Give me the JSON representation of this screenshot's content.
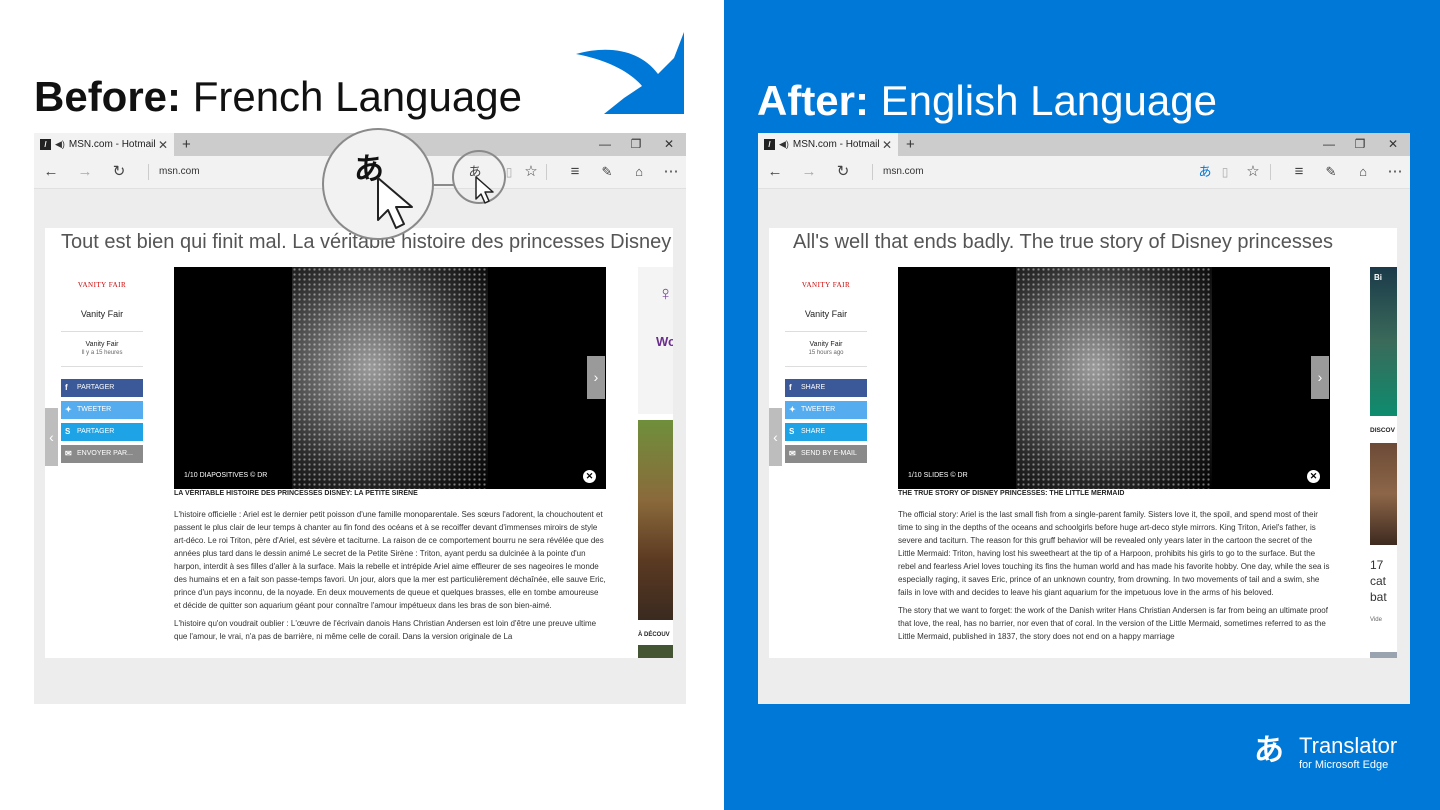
{
  "before_heading": {
    "bold": "Before:",
    "rest": "French Language"
  },
  "after_heading": {
    "bold": "After:",
    "rest": "English Language"
  },
  "colors": {
    "accent_blue": "#0078d7",
    "facebook": "#3b5998",
    "twitter": "#55acee",
    "skype": "#1ea4e6",
    "email_gray": "#8a8a8a"
  },
  "browser": {
    "tab_title": "MSN.com - Hotmail",
    "new_tab": "+",
    "address": "msn.com",
    "icons": [
      "back-icon",
      "forward-icon",
      "refresh-icon",
      "translate-icon",
      "reading-view-icon",
      "favorites-star-icon",
      "hub-icon",
      "web-note-icon",
      "share-icon",
      "more-icon"
    ]
  },
  "before": {
    "headline": "Tout est bien qui finit mal. La véritable histoire des princesses Disney",
    "source_logo": "VANITY FAIR",
    "source_name": "Vanity Fair",
    "source_small": "Vanity Fair",
    "time_ago": "Il y a 15 heures",
    "share": [
      "PARTAGER",
      "TWEETER",
      "PARTAGER",
      "ENVOYER PAR..."
    ],
    "slide_caption": "1/10 DIAPOSITIVES  © DR",
    "article_title": "LA VÉRITABLE HISTOIRE DES PRINCESSES DISNEY: LA PETITE SIRÈNE",
    "paragraph1": "L'histoire officielle : Ariel est le dernier petit poisson d'une famille monoparentale. Ses sœurs l'adorent, la chouchoutent et passent le plus clair de leur temps à chanter au fin fond des océans et à se recoiffer devant d'immenses miroirs de style art-déco. Le roi Triton, père d'Ariel, est sévère et taciturne. La raison de ce comportement bourru ne sera révélée que des années plus tard dans le dessin animé Le secret de la Petite Sirène : Triton, ayant perdu sa dulcinée à la pointe d'un harpon, interdit à ses filles d'aller à la surface. Mais la rebelle et intrépide Ariel aime effleurer de ses nageoires le monde des humains et en a fait son passe-temps favori. Un jour, alors que la mer est particulièrement déchaînée, elle sauve Eric, prince d'un pays inconnu, de la noyade. En deux mouvements de queue et quelques brasses, elle en tombe amoureuse et décide de quitter son aquarium géant pour connaître l'amour impétueux dans les bras de son bien-aimé.",
    "paragraph2": "L'histoire qu'on voudrait oublier : L'œuvre de l'écrivain danois Hans Christian Andersen est loin d'être une preuve ultime que l'amour, le vrai, n'a pas de barrière, ni même celle de corail. Dans la version originale de La",
    "ad_text": "Wo",
    "right_label": "À DÉCOUV"
  },
  "after": {
    "headline": "All's well that ends badly. The true story of Disney princesses",
    "source_logo": "VANITY FAIR",
    "source_name": "Vanity Fair",
    "source_small": "Vanity Fair",
    "time_ago": "15 hours ago",
    "share": [
      "SHARE",
      "TWEETER",
      "SHARE",
      "SEND BY E-MAIL"
    ],
    "slide_caption": "1/10 SLIDES  © DR",
    "article_title": "THE TRUE STORY OF DISNEY PRINCESSES: THE LITTLE MERMAID",
    "paragraph1": "The official story: Ariel is the last small fish from a single-parent family. Sisters love it, the spoil, and spend most of their time to sing in the depths of the oceans and schoolgirls before huge art-deco style mirrors. King Triton, Ariel's father, is severe and taciturn. The reason for this gruff behavior will be revealed only years later in the cartoon the secret of the Little Mermaid: Triton, having lost his sweetheart at the tip of a Harpoon, prohibits his girls to go to the surface. But the rebel and fearless Ariel loves touching its fins the human world and has made his favorite hobby. One day, while the sea is especially raging, it saves Eric, prince of an unknown country, from drowning. In two movements of tail and a swim, she fails in love with and decides to leave his giant aquarium for the impetuous love in the arms of his beloved.",
    "paragraph2": "The story that we want to forget: the work of the Danish writer Hans Christian Andersen is far from being an ultimate proof that love, the real, has no barrier, nor even that of coral. In the version of the Little Mermaid, sometimes referred to as the Little Mermaid, published in 1837, the story does not end on a happy marriage",
    "bing_text": "Bi",
    "discover_label": "DISCOV",
    "side_number": "17",
    "side_text1": "cat",
    "side_text2": "bat",
    "side_small": "Vide"
  },
  "logo": {
    "name": "Translator",
    "sub": "for Microsoft Edge"
  }
}
